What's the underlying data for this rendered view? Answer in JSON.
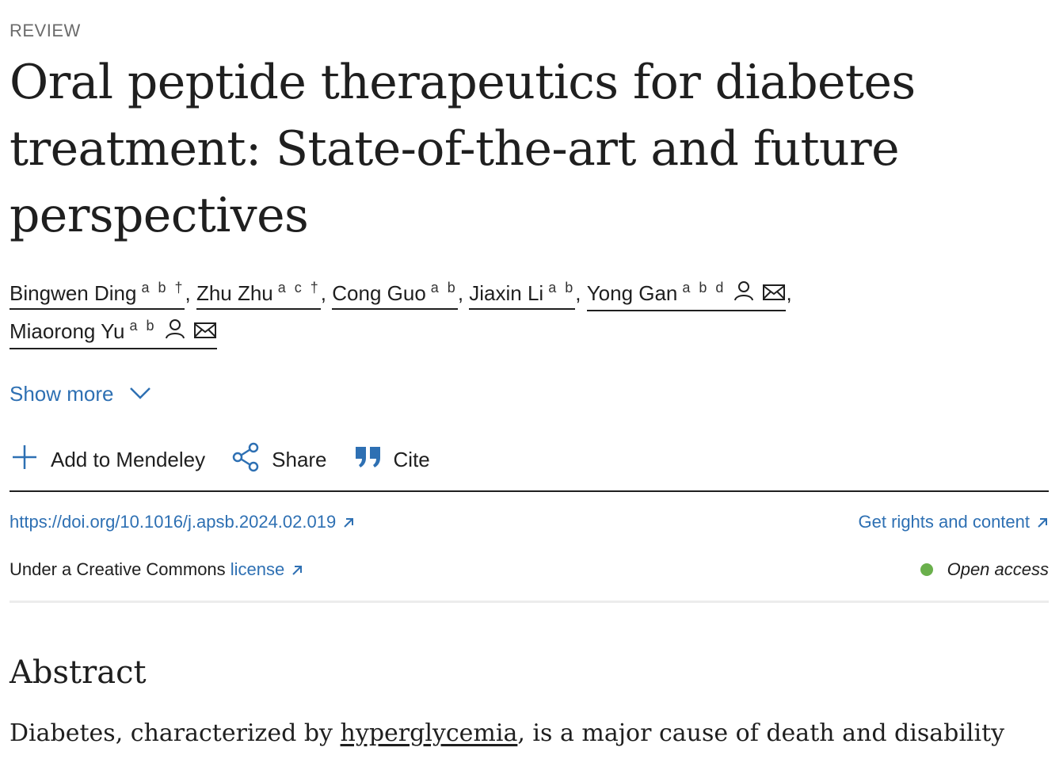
{
  "article_type": "REVIEW",
  "title": "Oral peptide therapeutics for diabetes treatment: State-of-the-art and future perspectives",
  "authors": [
    {
      "name": "Bingwen Ding",
      "affil": "a b †",
      "sep": ", "
    },
    {
      "name": "Zhu Zhu",
      "affil": "a c †",
      "sep": ", "
    },
    {
      "name": "Cong Guo",
      "affil": "a b",
      "sep": ", "
    },
    {
      "name": "Jiaxin Li",
      "affil": "a b",
      "sep": ", "
    },
    {
      "name": "Yong Gan",
      "affil": "a b d",
      "sep": ","
    },
    {
      "name": "Miaorong Yu",
      "affil": "a b",
      "sep": ""
    }
  ],
  "show_more": "Show more",
  "actions": {
    "mendeley": "Add to Mendeley",
    "share": "Share",
    "cite": "Cite"
  },
  "doi": "https://doi.org/10.1016/j.apsb.2024.02.019",
  "rights": "Get rights and content",
  "license": {
    "prefix": "Under a Creative Commons ",
    "link": "license"
  },
  "open_access": "Open access",
  "abstract": {
    "heading": "Abstract",
    "text_before": "Diabetes, characterized by ",
    "keyword": "hyperglycemia",
    "text_after": ", is a major cause of death and disability"
  },
  "colors": {
    "link": "#2e70b3",
    "text": "#1f1f1f",
    "open_access_dot": "#6ab04c"
  }
}
